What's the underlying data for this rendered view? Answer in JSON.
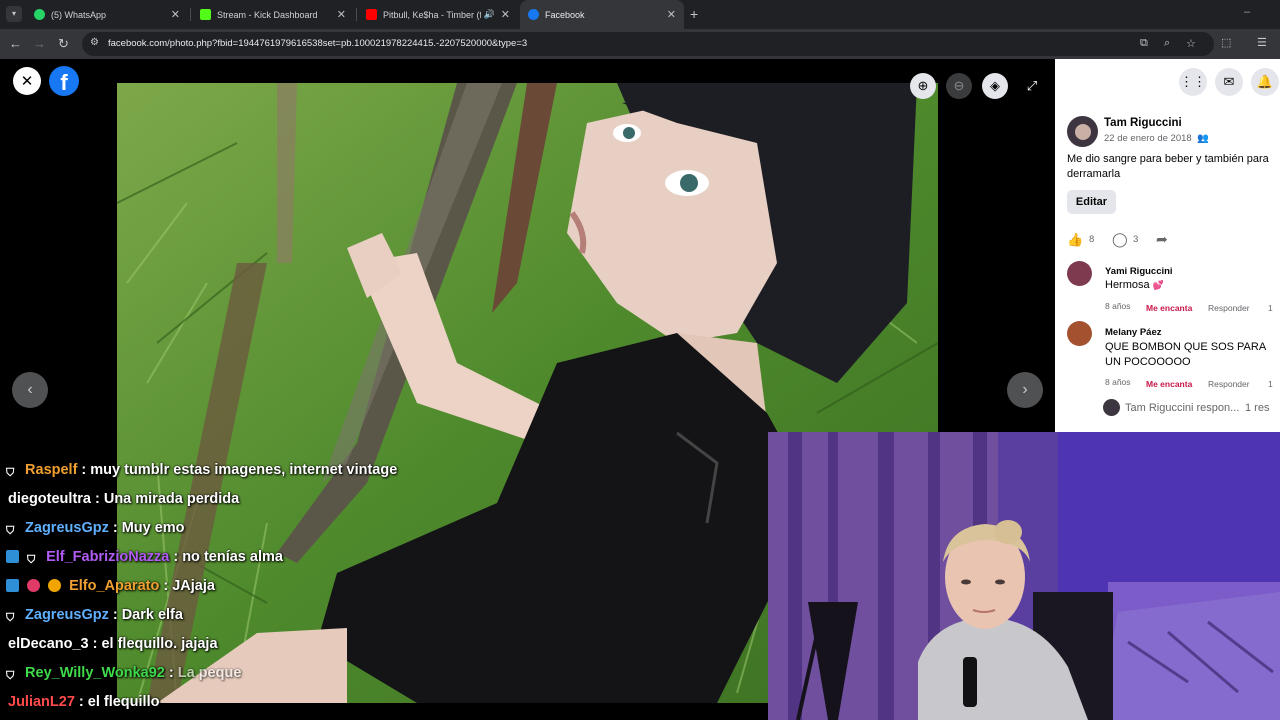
{
  "browser": {
    "tabs": [
      {
        "label": "(5) WhatsApp",
        "icon": "whatsapp-icon",
        "color": "#25d366"
      },
      {
        "label": "Stream - Kick Dashboard",
        "icon": "kick-icon",
        "color": "#53fc18"
      },
      {
        "label": "Pitbull, Ke$ha - Timber (fea",
        "icon": "youtube-icon",
        "color": "#ff0000"
      },
      {
        "label": "Facebook",
        "icon": "facebook-icon",
        "color": "#1877f2"
      }
    ],
    "url": "facebook.com/photo.php?fbid=1944761979616538set=pb.100021978224415.-2207520000&type=3"
  },
  "post": {
    "author": "Tam Riguccini",
    "date": "22 de enero de 2018",
    "caption": "Me dio sangre para beber y también para derramarla",
    "edit_label": "Editar",
    "likes": "8",
    "comments": "3",
    "comment_list": [
      {
        "name": "Yami Riguccini",
        "text": "Hermosa",
        "age": "8 años",
        "reaction": "Me encanta",
        "reply": "Responder",
        "count": "1"
      },
      {
        "name": "Melany Páez",
        "text": "QUE BOMBON QUE SOS PARA UN POCOOOOO",
        "age": "8 años",
        "reaction": "Me encanta",
        "reply": "Responder",
        "count": "1"
      }
    ],
    "reply_preview": "Tam Riguccini respon...",
    "reply_count": "1 res"
  },
  "chat": [
    {
      "badges": [
        "shield"
      ],
      "user": "Raspelf",
      "color": "#f0a030",
      "text": "muy tumblr estas imagenes, internet vintage"
    },
    {
      "badges": [],
      "user": "diegoteultra",
      "color": "#ffffff",
      "text": "Una mirada perdida"
    },
    {
      "badges": [
        "shield"
      ],
      "user": "ZagreusGpz",
      "color": "#5fb0ff",
      "text": "Muy emo"
    },
    {
      "badges": [
        "prime",
        "shield"
      ],
      "user": "Elf_FabrizioNazza",
      "color": "#b15bf5",
      "text": "no tenías alma"
    },
    {
      "badges": [
        "prime",
        "sub",
        "gift"
      ],
      "user": "Elfo_Aparato",
      "color": "#f0a030",
      "text": "JAjaja"
    },
    {
      "badges": [
        "shield"
      ],
      "user": "ZagreusGpz",
      "color": "#5fb0ff",
      "text": "Dark elfa"
    },
    {
      "badges": [],
      "user": "elDecano_3",
      "color": "#ffffff",
      "text": "el flequillo. jajaja"
    },
    {
      "badges": [
        "shield"
      ],
      "user": "Rey_Willy_Wonka92",
      "color": "#3fd94a",
      "text": "La peque"
    },
    {
      "badges": [],
      "user": "JulianL27",
      "color": "#ff4a4a",
      "text": "el flequillo"
    }
  ]
}
